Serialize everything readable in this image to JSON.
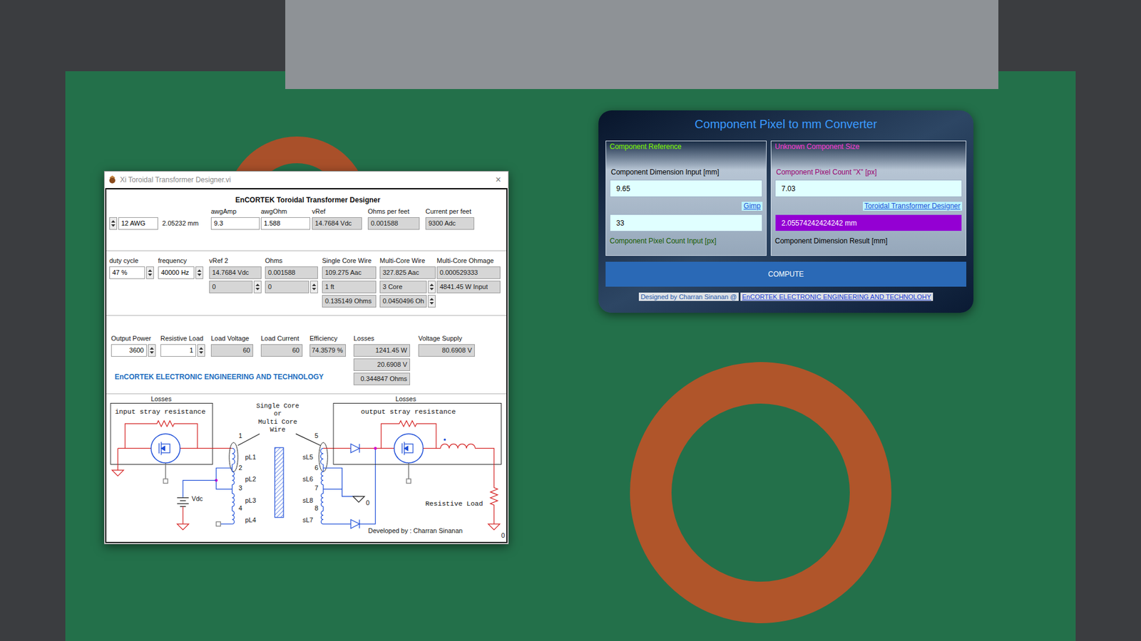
{
  "designer": {
    "title": "Xi Toroidal Transformer Designer.vi",
    "close": "×",
    "heading": "EnCORTEK Toroidal Transformer Designer",
    "wire_section": [
      {
        "cells": [
          {
            "text": "12 AWG",
            "kind": "control-spin-left"
          }
        ]
      },
      {
        "cells": [
          {
            "text": "2.05232 mm",
            "kind": "readout"
          }
        ]
      },
      {
        "label": "awgAmp",
        "cells": [
          {
            "text": "9.3",
            "kind": "control"
          }
        ]
      },
      {
        "label": "awgOhm",
        "cells": [
          {
            "text": "1.588",
            "kind": "control"
          }
        ]
      },
      {
        "label": "vRef",
        "cells": [
          {
            "text": "14.7684 Vdc",
            "kind": "indicator"
          }
        ]
      },
      {
        "label": "Ohms per feet",
        "cells": [
          {
            "text": "0.001588",
            "kind": "indicator"
          }
        ]
      },
      {
        "label": "Current per feet",
        "cells": [
          {
            "text": "9300 Adc",
            "kind": "indicator"
          }
        ]
      }
    ],
    "drive_section": [
      {
        "label": "duty cycle",
        "cells": [
          {
            "text": "47 %",
            "kind": "control-spin"
          }
        ]
      },
      {
        "label": "frequency",
        "cells": [
          {
            "text": "40000 Hz",
            "kind": "control-spin"
          }
        ]
      },
      {
        "label": "vRef 2",
        "cells": [
          {
            "text": "14.7684 Vdc",
            "kind": "indicator"
          },
          {
            "text": "0",
            "kind": "indicator-spin"
          }
        ]
      },
      {
        "label": "Ohms",
        "cells": [
          {
            "text": "0.001588",
            "kind": "indicator"
          },
          {
            "text": "0",
            "kind": "indicator-spin"
          }
        ]
      },
      {
        "label": "Single Core Wire",
        "cells": [
          {
            "text": "109.275 Aac",
            "kind": "indicator"
          },
          {
            "text": "1 ft",
            "kind": "indicator"
          },
          {
            "text": "0.135149 Ohms",
            "kind": "indicator"
          }
        ]
      },
      {
        "label": "Multi-Core Wire",
        "cells": [
          {
            "text": "327.825 Aac",
            "kind": "indicator"
          },
          {
            "text": "3 Core",
            "kind": "indicator-spin"
          },
          {
            "text": "0.0450496 Oh",
            "kind": "indicator-spin"
          }
        ]
      },
      {
        "label": "Multi-Core Ohmage",
        "cells": [
          {
            "text": "0.000529333",
            "kind": "indicator"
          },
          {
            "text": "4841.45 W Input",
            "kind": "indicator"
          }
        ]
      }
    ],
    "power_section": [
      {
        "label": "Output Power",
        "cells": [
          {
            "text": "3600",
            "kind": "control-spin"
          }
        ]
      },
      {
        "label": "Resistive Load",
        "cells": [
          {
            "text": "1",
            "kind": "control-spin"
          }
        ]
      },
      {
        "label": "Load Voltage",
        "cells": [
          {
            "text": "60",
            "kind": "indicator"
          }
        ]
      },
      {
        "label": "Load Current",
        "cells": [
          {
            "text": "60",
            "kind": "indicator"
          }
        ]
      },
      {
        "label": "Efficiency",
        "cells": [
          {
            "text": "74.3579 %",
            "kind": "indicator"
          }
        ]
      },
      {
        "label": "Losses",
        "cells": [
          {
            "text": "1241.45 W",
            "kind": "indicator"
          },
          {
            "text": "20.6908 V",
            "kind": "indicator"
          },
          {
            "text": "0.344847 Ohms",
            "kind": "indicator"
          }
        ]
      },
      {
        "label": "Voltage Supply",
        "cells": [
          {
            "text": "80.6908 V",
            "kind": "indicator"
          }
        ]
      }
    ],
    "company": "EnCORTEK ELECTRONIC ENGINEERING AND TECHNOLOGY",
    "diagram": {
      "input_title": "Losses",
      "input_label": "input stray resistance",
      "core_note": [
        "Single Core",
        "or",
        "Multi Core",
        "Wire"
      ],
      "output_title": "Losses",
      "output_label": "output stray resistance",
      "primary_nodes": [
        "1",
        "2",
        "3",
        "4"
      ],
      "primary_coils": [
        "pL1",
        "pL2",
        "pL3",
        "pL4"
      ],
      "secondary_nodes": [
        "5",
        "6",
        "7",
        "8"
      ],
      "secondary_coils": [
        "sL5",
        "sL6",
        "sL8",
        "sL7"
      ],
      "supply": "Vdc",
      "grounds": [
        "0",
        "0"
      ],
      "load": "Resistive Load",
      "credit": "Developed by : Charran Sinanan"
    }
  },
  "converter": {
    "title": "Component Pixel to mm Converter",
    "reference": {
      "legend": "Component Reference",
      "dimension_label": "Component Dimension Input [mm]",
      "dimension_value": "9.65",
      "link": "Gimp",
      "pixel_value": "33",
      "pixel_label": "Component Pixel Count Input [px]"
    },
    "unknown": {
      "legend": "Unknown Component Size",
      "pixel_label": "Component Pixel Count \"X\" [px]",
      "pixel_value": "7.03",
      "link": "Toroidal Transformer Designer",
      "result_value": "2.05574242424242 mm",
      "result_label": "Component Dimension Result [mm]"
    },
    "button": "COMPUTE",
    "footer": {
      "text": "Designed by Charran Sinanan @",
      "link": "EnCORTEK ELECTRONIC ENGINEERING AND TECHNOLOHY"
    }
  }
}
